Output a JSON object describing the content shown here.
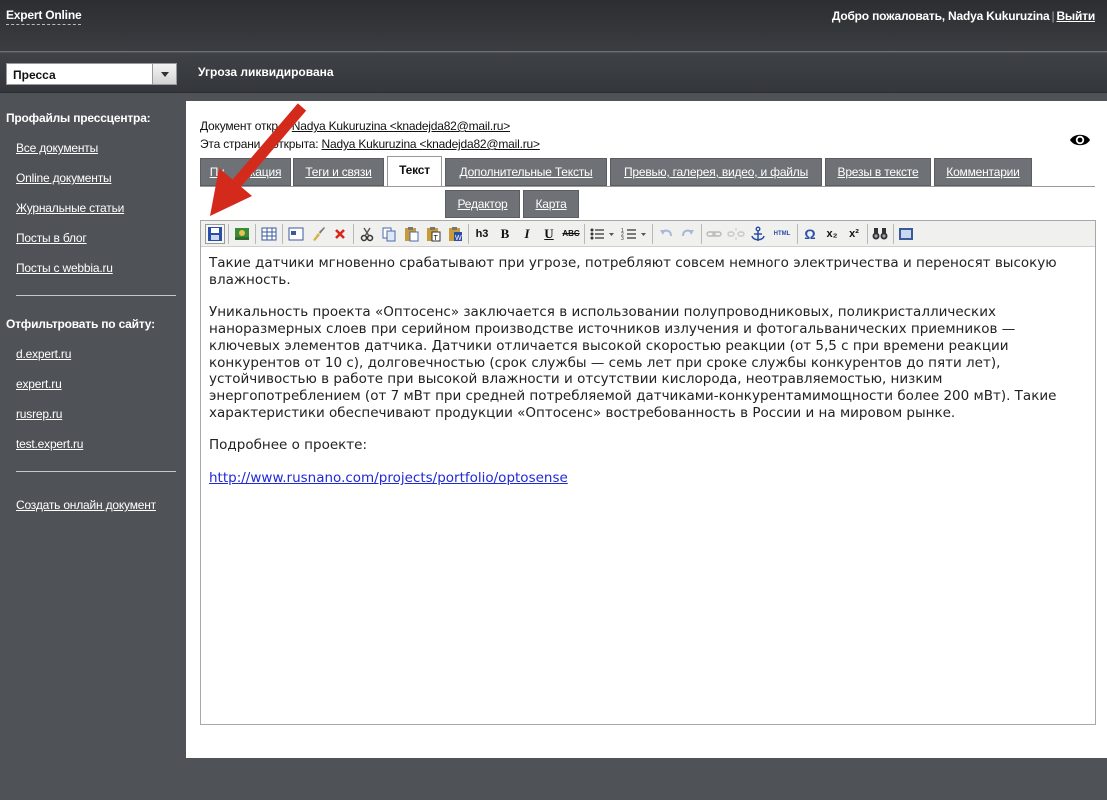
{
  "header": {
    "brand": "Expert Online",
    "welcome": "Добро пожаловать, Nadya Kukuruzina",
    "logout": "Выйти"
  },
  "section_select": {
    "value": "Пресса"
  },
  "document_title": "Угроза ликвидирована",
  "sidebar": {
    "profiles_heading": "Профайлы прессцентра:",
    "profile_links": [
      "Все документы",
      "Online документы",
      "Журнальные статьи",
      "Посты в блог",
      "Посты с webbia.ru"
    ],
    "filter_heading": "Отфильтровать по сайту:",
    "site_links": [
      "d.expert.ru",
      "expert.ru",
      "rusrep.ru",
      "test.expert.ru"
    ],
    "create_link": "Создать онлайн документ"
  },
  "meta": {
    "doc_opened_label": "Документ откр",
    "doc_opened_user": "Nadya Kukuruzina <knadejda82@mail.ru>",
    "page_opened_label": "Эта страни",
    "page_opened_label2": "открыта:",
    "page_opened_user": "Nadya Kukuruzina <knadejda82@mail.ru>"
  },
  "tabs": [
    {
      "label": "Пу",
      "suffix": "кация"
    },
    {
      "label": "Теги и связи"
    },
    {
      "label": "Текст"
    },
    {
      "label": "Дополнительные Тексты"
    },
    {
      "label": "Превью, галерея, видео, и файлы"
    },
    {
      "label": "Врезы в тексте"
    },
    {
      "label": "Комментарии"
    }
  ],
  "subtabs": [
    {
      "label": "Редактор"
    },
    {
      "label": "Карта"
    }
  ],
  "toolbar": {
    "h3": "h3",
    "bold": "B",
    "italic": "I",
    "underline": "U",
    "strike": "ABC",
    "html": "HTML",
    "omega": "Ω",
    "sub": "x₂",
    "sup": "x²"
  },
  "content": {
    "p1": "Такие датчики мгновенно срабатывают при угрозе, потребляют совсем немного электричества и переносят высокую влажность.",
    "p2": "Уникальность проекта «Оптосенс» заключается в использовании полупроводниковых, поликристаллических наноразмерных слоев при серийном производстве источников излучения и фотогальванических приемников — ключевых элементов датчика. Датчики отличается высокой скоростью реакции (от 5,5 с при времени реакции конкурентов от 10 с), долговечностью (срок службы — семь лет при сроке службы конкурентов до пяти лет), устойчивостью в работе при высокой влажности и отсутствии кислорода, неотравляемостью, низким энергопотреблением (от 7 мВт при средней потребляемой датчиками-конкурентамимощности более 200 мВт). Такие характеристики обеспечивают продукции «Оптосенс» востребованность в России и на мировом рынке.",
    "p3": "Подробнее о проекте:",
    "link": "http://www.rusnano.com/projects/portfolio/optosense"
  },
  "colors": {
    "arrow": "#d42a1c",
    "link": "#1f2ad6"
  }
}
